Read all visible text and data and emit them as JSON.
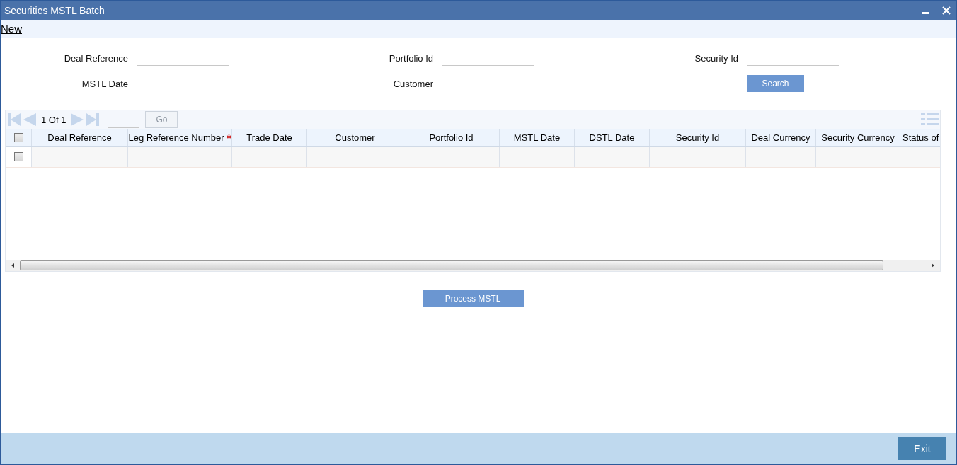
{
  "window": {
    "title": "Securities MSTL Batch"
  },
  "menu": [
    {
      "label": "New"
    }
  ],
  "form": {
    "fields": [
      {
        "label": "Deal Reference"
      },
      {
        "label": "Portfolio Id"
      },
      {
        "label": "Security Id"
      },
      {
        "label": "MSTL Date"
      },
      {
        "label": "Customer"
      }
    ],
    "search_button": "Search"
  },
  "pager": {
    "text": "1 Of 1",
    "go_button": "Go",
    "go_disabled": true
  },
  "table": {
    "select_all_checked": false,
    "columns": [
      {
        "label": "Deal Reference",
        "required": false
      },
      {
        "label": "Leg Reference Number",
        "required": true
      },
      {
        "label": "Trade Date",
        "required": false
      },
      {
        "label": "Customer",
        "required": false
      },
      {
        "label": "Portfolio Id",
        "required": false
      },
      {
        "label": "MSTL Date",
        "required": false
      },
      {
        "label": "DSTL Date",
        "required": false
      },
      {
        "label": "Security Id",
        "required": false
      },
      {
        "label": "Deal Currency",
        "required": false
      },
      {
        "label": "Security Currency",
        "required": false
      },
      {
        "label": "Status of",
        "required": false
      }
    ],
    "rows": [
      {
        "checked": false
      }
    ]
  },
  "process_button": "Process MSTL",
  "footer": {
    "exit_button": "Exit"
  }
}
